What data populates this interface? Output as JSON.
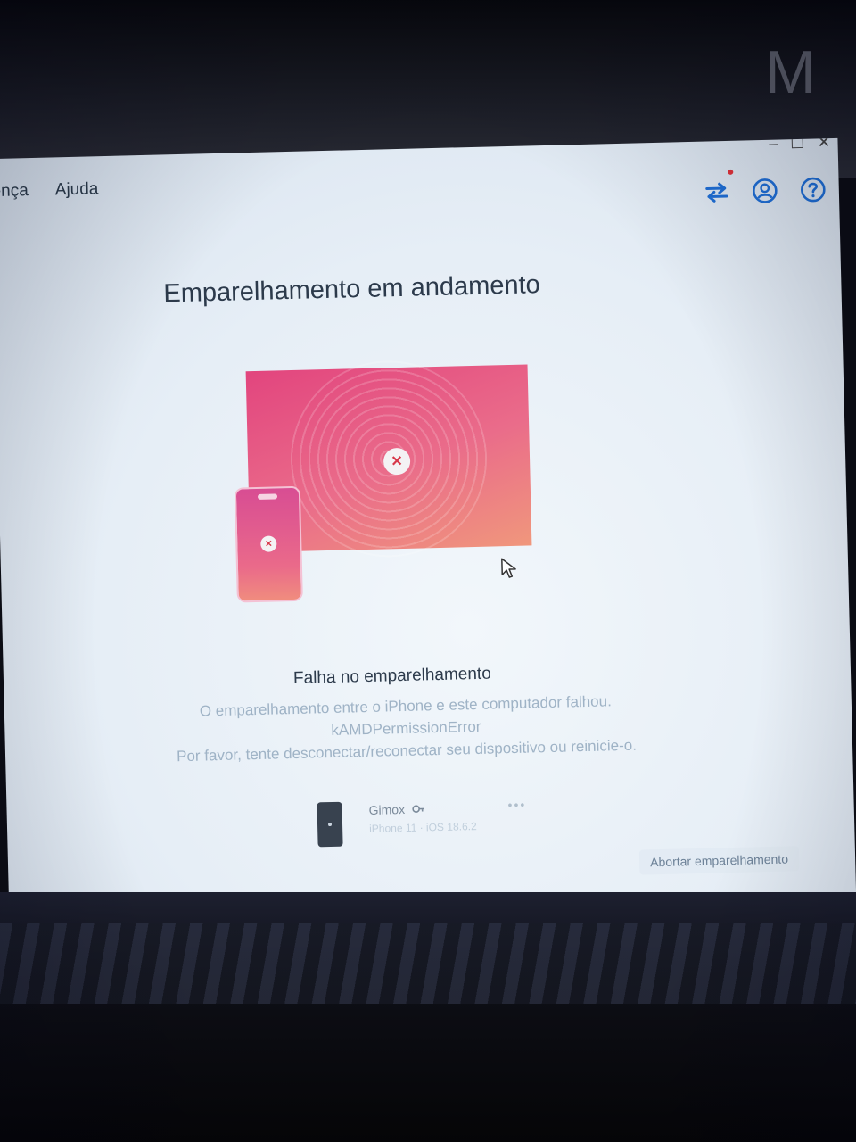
{
  "background": {
    "letter": "M"
  },
  "window": {
    "controls": {
      "minimize": "–",
      "maximize": "☐",
      "close": "✕"
    }
  },
  "menu": [
    "ença",
    "Ajuda"
  ],
  "toolbar": {
    "icons": [
      "transfer-icon",
      "account-icon",
      "help-icon"
    ],
    "notification_color": "#e0333a"
  },
  "main": {
    "title": "Emparelhamento em andamento",
    "status_title": "Falha no emparelhamento",
    "error_lines": [
      "O emparelhamento entre o iPhone e este computador falhou.",
      "kAMDPermissionError",
      "Por favor, tente desconectar/reconectar seu dispositivo ou reinicie-o."
    ],
    "device": {
      "name": "Gimox",
      "subtitle": "iPhone 11 · iOS 18.6.2",
      "more": "•••"
    },
    "abort_label": "Abortar emparelhamento"
  },
  "colors": {
    "accent": "#1f6fd6",
    "illustration_start": "#e2457e",
    "illustration_end": "#f0977c",
    "error": "#d8384a"
  }
}
